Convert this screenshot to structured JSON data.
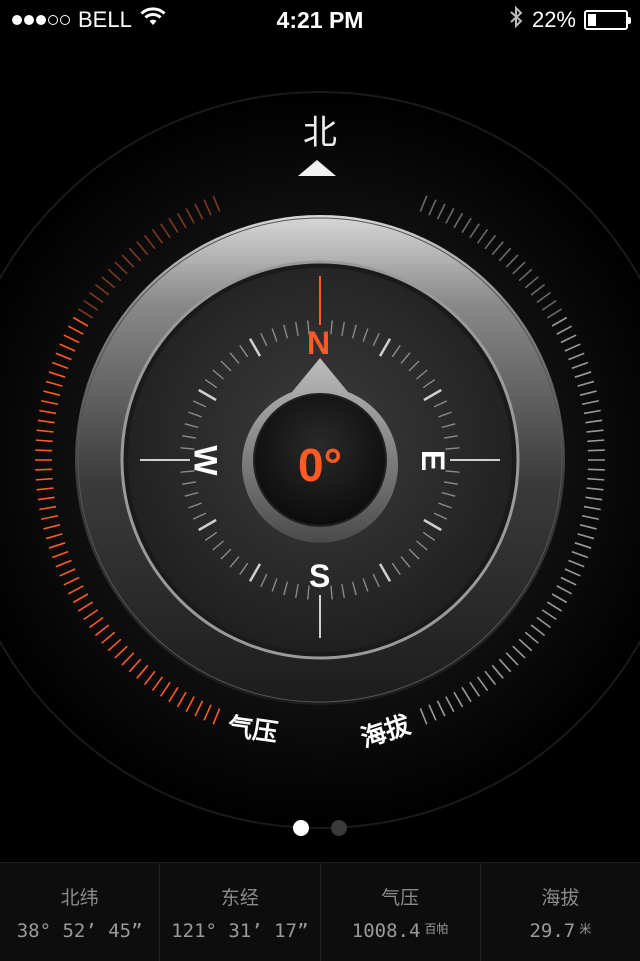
{
  "status_bar": {
    "carrier": "BELL",
    "time": "4:21 PM",
    "battery_percent": "22%",
    "battery_level": 0.22,
    "signal_bars_filled": 3,
    "signal_bars_total": 5,
    "icons": [
      "wifi-icon",
      "bluetooth-icon",
      "battery-icon"
    ]
  },
  "compass": {
    "north_label": "北",
    "heading": "0°",
    "directions": {
      "n": "N",
      "s": "S",
      "e": "E",
      "w": "W"
    },
    "left_arc_label": "气压",
    "right_arc_label": "海拔",
    "accent_color": "#ff5a24"
  },
  "pager": {
    "pages": 2,
    "active": 0
  },
  "info": [
    {
      "title": "北纬",
      "value": "38° 52’ 45”",
      "unit": ""
    },
    {
      "title": "东经",
      "value": "121° 31’ 17”",
      "unit": ""
    },
    {
      "title": "气压",
      "value": "1008.4",
      "unit": "百帕"
    },
    {
      "title": "海拔",
      "value": "29.7",
      "unit": "米"
    }
  ]
}
